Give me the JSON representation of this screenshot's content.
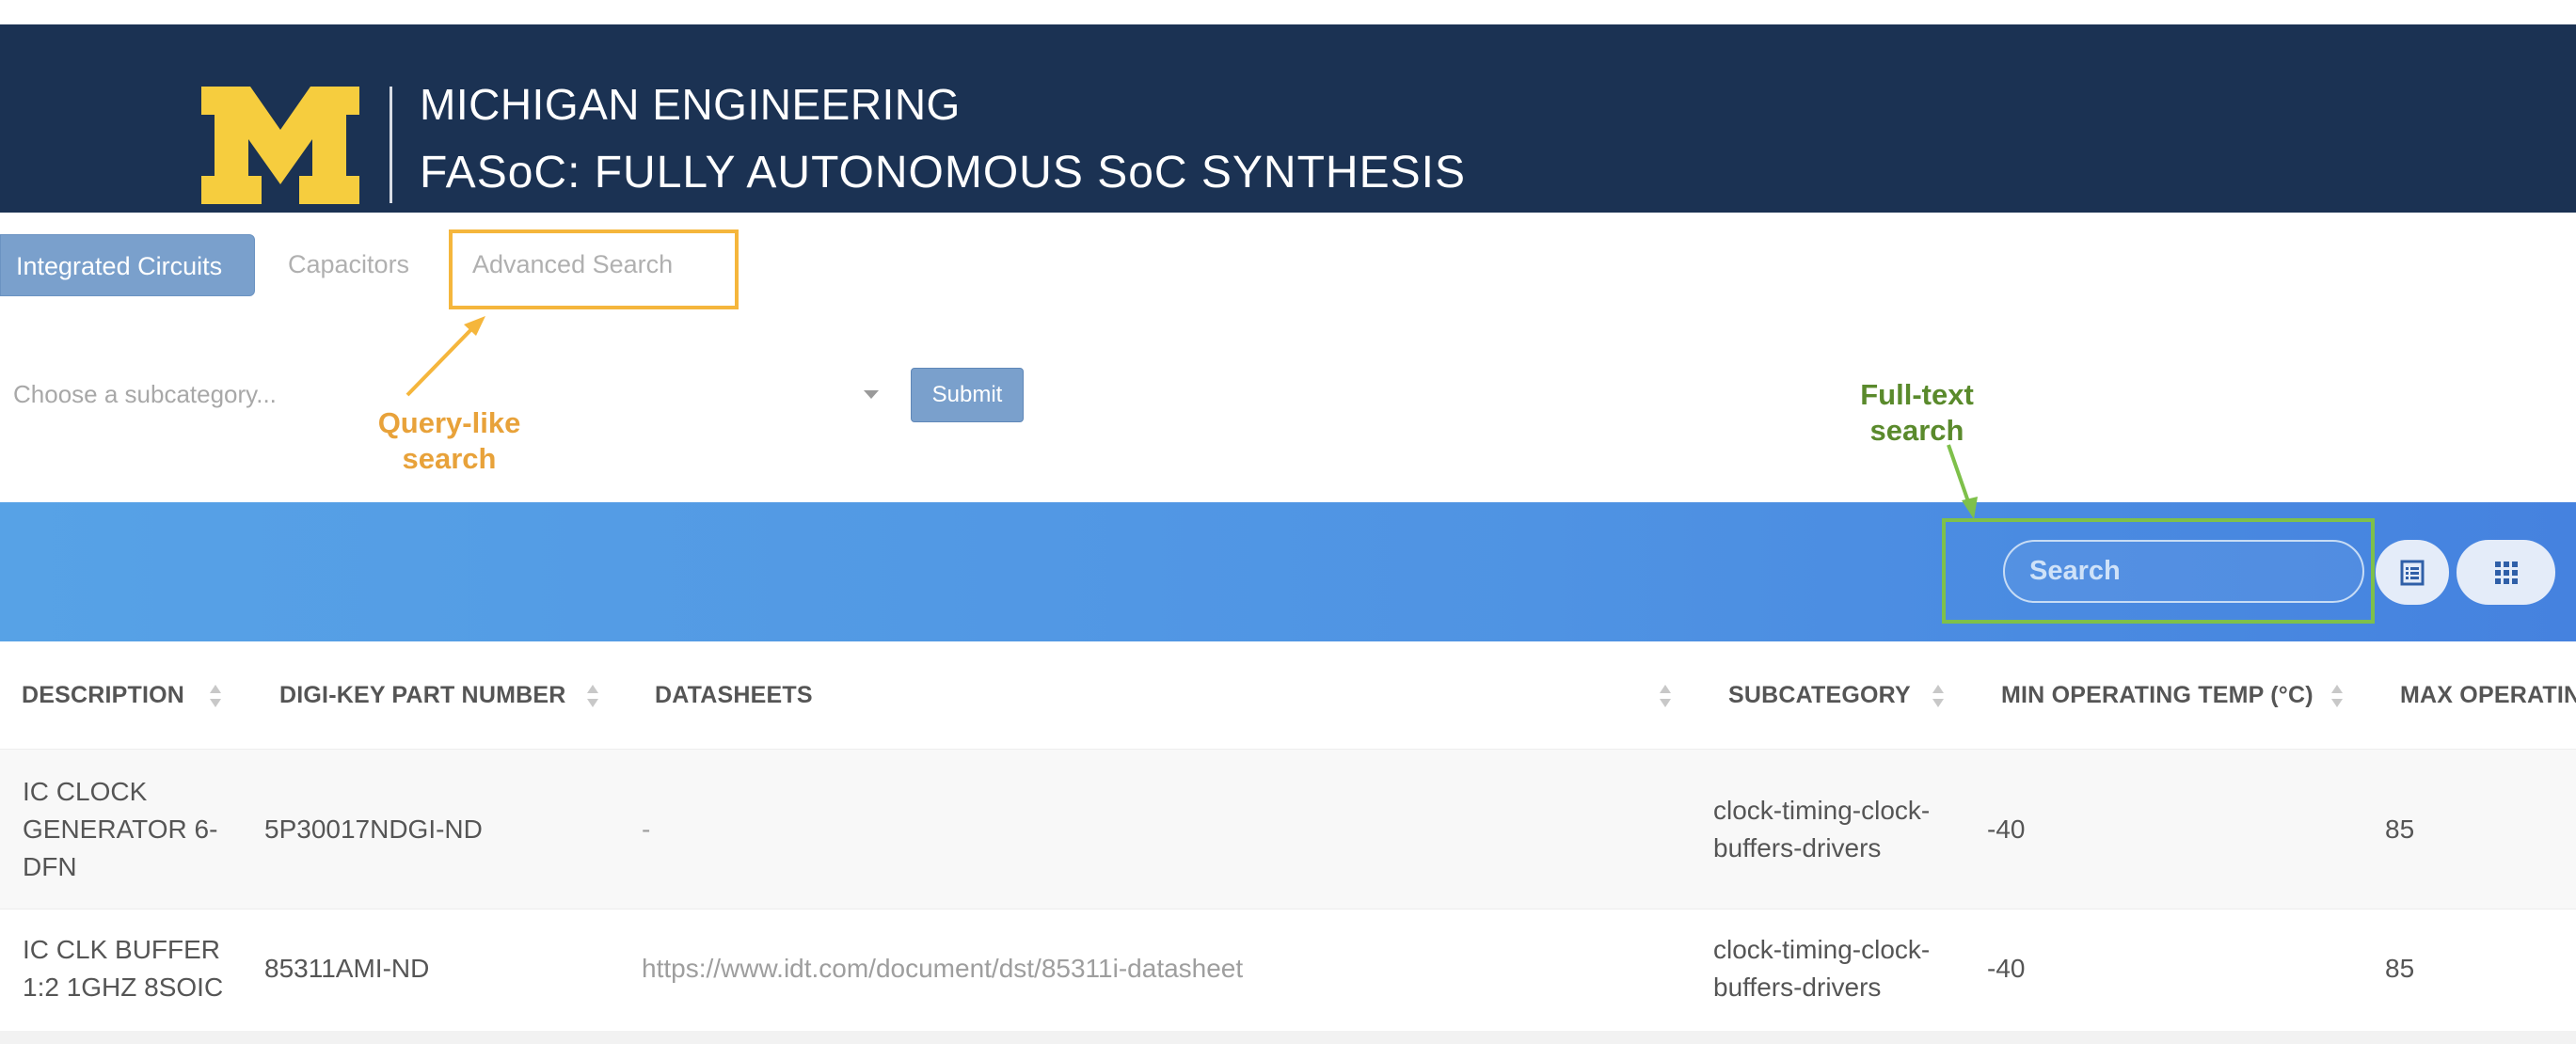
{
  "header": {
    "line1": "MICHIGAN ENGINEERING",
    "line2": "FASoC: FULLY AUTONOMOUS SoC SYNTHESIS",
    "logo_color": "#f6cd3e",
    "background": "#1b3253"
  },
  "tabs": [
    {
      "label": "Integrated Circuits",
      "active": true
    },
    {
      "label": "Capacitors",
      "active": false
    },
    {
      "label": "Advanced Search",
      "active": false
    }
  ],
  "filter": {
    "placeholder": "Choose a subcategory...",
    "submit_label": "Submit"
  },
  "annotations": {
    "query": {
      "line1": "Query-like",
      "line2": "search",
      "color": "#e8a23a"
    },
    "fulltext": {
      "line1": "Full-text",
      "line2": "search",
      "color": "#5a8a2c"
    }
  },
  "toolbar": {
    "search_placeholder": "Search",
    "list_icon": "list-view-icon",
    "grid_icon": "grid-view-icon"
  },
  "table": {
    "columns": [
      "DESCRIPTION",
      "DIGI-KEY PART NUMBER",
      "DATASHEETS",
      "SUBCATEGORY",
      "MIN OPERATING TEMP (°C)",
      "MAX OPERATING TEMP (°C)"
    ],
    "rows": [
      {
        "description": [
          "IC CLOCK",
          "GENERATOR 6-",
          "DFN"
        ],
        "part_number": "5P30017NDGI-ND",
        "datasheet": "-",
        "subcategory": [
          "clock-timing-clock-",
          "buffers-drivers"
        ],
        "min_temp": "-40",
        "max_temp": "85"
      },
      {
        "description": [
          "IC CLK BUFFER",
          "1:2 1GHZ 8SOIC"
        ],
        "part_number": "85311AMI-ND",
        "datasheet": "https://www.idt.com/document/dst/85311i-datasheet",
        "subcategory": [
          "clock-timing-clock-",
          "buffers-drivers"
        ],
        "min_temp": "-40",
        "max_temp": "85"
      }
    ]
  }
}
